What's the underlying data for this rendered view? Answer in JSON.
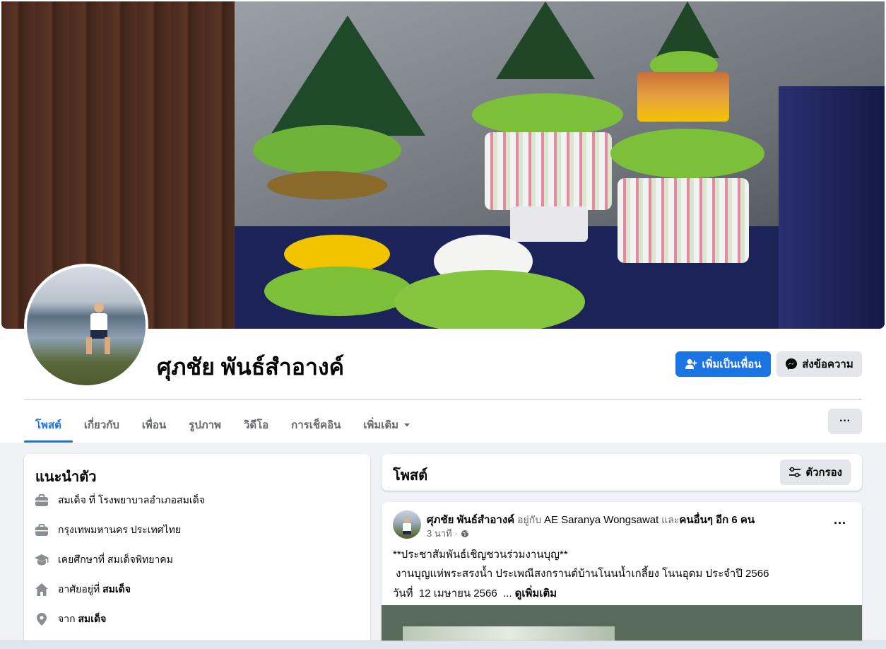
{
  "profile": {
    "name": "ศุภชัย พันธ์สำอางค์",
    "add_friend_label": "เพิ่มเป็นเพื่อน",
    "message_label": "ส่งข้อความ"
  },
  "tabs": [
    {
      "label": "โพสต์",
      "active": true
    },
    {
      "label": "เกี่ยวกับ"
    },
    {
      "label": "เพื่อน"
    },
    {
      "label": "รูปภาพ"
    },
    {
      "label": "วิดีโอ"
    },
    {
      "label": "การเช็คอิน"
    },
    {
      "label": "เพิ่มเติม"
    }
  ],
  "more_button_label": "···",
  "intro": {
    "title": "แนะนำตัว",
    "items": [
      {
        "icon": "briefcase-icon",
        "text": "สมเด็จ ที่ โรงพยาบาลอำเภอสมเด็จ"
      },
      {
        "icon": "briefcase-icon",
        "text": "กรุงเทพมหานคร ประเทศไทย"
      },
      {
        "icon": "graduation-cap-icon",
        "text": "เคยศึกษาที่ สมเด็จพิทยาคม"
      },
      {
        "icon": "home-icon",
        "prefix": "อาศัยอยู่ที่ ",
        "bold": "สมเด็จ"
      },
      {
        "icon": "location-pin-icon",
        "prefix": "จาก ",
        "bold": "สมเด็จ"
      }
    ]
  },
  "posts_header": {
    "title": "โพสต์",
    "filter_label": "ตัวกรอง"
  },
  "post": {
    "author": "ศุภชัย พันธ์สำอางค์",
    "with_text": " อยู่กับ ",
    "tagged": "AE Saranya Wongsawat",
    "and_text": " และ",
    "others": "คนอื่นๆ อีก 6 คน",
    "time": "3 นาที ·",
    "line1": "**ประชาสัมพันธ์เชิญชวนร่วมงานบุญ**",
    "line2": " งานบุญแห่พระสรงน้ำ ประเพณีสงกรานต์บ้านโนนน้ำเกลี้ยง โนนอุดม ประจำปี 2566",
    "line3": "วันที่  12 เมษายน 2566  ... ",
    "see_more": "ดูเพิ่มเติม",
    "menu_label": "···"
  },
  "colors": {
    "accent": "#1b74e4",
    "background": "#f0f2f5",
    "button_gray": "#e4e6eb",
    "muted_text": "#65676b"
  }
}
